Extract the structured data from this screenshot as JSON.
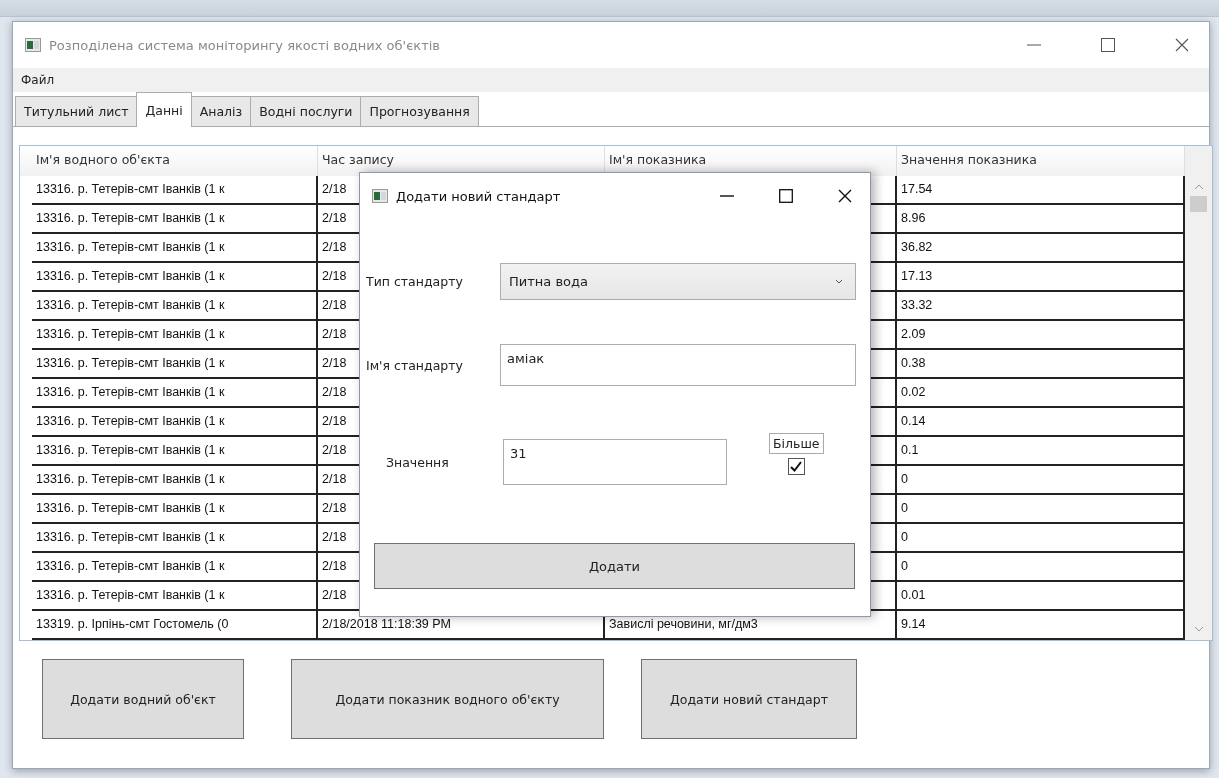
{
  "window": {
    "title": "Розподілена система моніторингу якості водних об'єктів",
    "menu": [
      "Файл"
    ],
    "tabs": [
      {
        "label": "Титульний лист",
        "selected": false
      },
      {
        "label": "Данні",
        "selected": true
      },
      {
        "label": "Аналіз",
        "selected": false
      },
      {
        "label": "Водні послуги",
        "selected": false
      },
      {
        "label": "Прогнозування",
        "selected": false
      }
    ]
  },
  "table": {
    "columns": [
      "Ім'я водного об'єкта",
      "Час запису",
      "Ім'я показника",
      "Значення показника"
    ],
    "rows": [
      {
        "name": "13316. р. Тетерів-смт Іванків (1 к",
        "time": "2/18",
        "value": "17.54"
      },
      {
        "name": "13316. р. Тетерів-смт Іванків (1 к",
        "time": "2/18",
        "value": "8.96"
      },
      {
        "name": "13316. р. Тетерів-смт Іванків (1 к",
        "time": "2/18",
        "value": "36.82"
      },
      {
        "name": "13316. р. Тетерів-смт Іванків (1 к",
        "time": "2/18",
        "value": "17.13"
      },
      {
        "name": "13316. р. Тетерів-смт Іванків (1 к",
        "time": "2/18",
        "value": "33.32"
      },
      {
        "name": "13316. р. Тетерів-смт Іванків (1 к",
        "time": "2/18",
        "value": "2.09"
      },
      {
        "name": "13316. р. Тетерів-смт Іванків (1 к",
        "time": "2/18",
        "value": "0.38"
      },
      {
        "name": "13316. р. Тетерів-смт Іванків (1 к",
        "time": "2/18",
        "value": "0.02"
      },
      {
        "name": "13316. р. Тетерів-смт Іванків (1 к",
        "time": "2/18",
        "value": "0.14"
      },
      {
        "name": "13316. р. Тетерів-смт Іванків (1 к",
        "time": "2/18",
        "value": "0.1"
      },
      {
        "name": "13316. р. Тетерів-смт Іванків (1 к",
        "time": "2/18",
        "value": "0"
      },
      {
        "name": "13316. р. Тетерів-смт Іванків (1 к",
        "time": "2/18",
        "value": "0"
      },
      {
        "name": "13316. р. Тетерів-смт Іванків (1 к",
        "time": "2/18",
        "value": "0"
      },
      {
        "name": "13316. р. Тетерів-смт Іванків (1 к",
        "time": "2/18",
        "value": "0"
      },
      {
        "name": "13316. р. Тетерів-смт Іванків (1 к",
        "time": "2/18",
        "value": "0.01"
      },
      {
        "name": "13319. р. Ірпінь-смт Гостомель (0",
        "time": "2/18/2018 11:18:39 PM",
        "indicator": "Завислі речовини, мг/дм3",
        "value": "9.14"
      }
    ]
  },
  "buttons": [
    "Додати водний об'єкт",
    "Додати показник водного об'єкту",
    "Додати новий стандарт"
  ],
  "dialog": {
    "title": "Додати новий стандарт",
    "fields": [
      {
        "kind": "dropdown",
        "label": "Тип стандарту",
        "value": "Питна вода"
      },
      {
        "kind": "text",
        "label": "Ім'я стандарту",
        "value": "аміак"
      },
      {
        "kind": "short",
        "label": "Значення",
        "value": "31"
      }
    ],
    "checkbox": {
      "label": "Більше",
      "checked": true
    },
    "button": "Додати"
  }
}
